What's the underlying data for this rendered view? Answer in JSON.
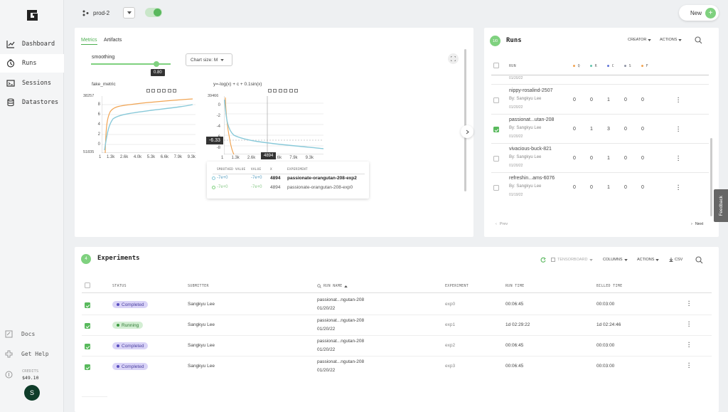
{
  "app": {
    "logo": "G",
    "project": "prod-2",
    "new_button": "New"
  },
  "sidebar": {
    "items": [
      {
        "label": "Dashboard",
        "icon": "chart-line-icon"
      },
      {
        "label": "Runs",
        "icon": "runs-icon"
      },
      {
        "label": "Sessions",
        "icon": "sessions-icon"
      },
      {
        "label": "Datastores",
        "icon": "database-icon"
      }
    ],
    "docs": "Docs",
    "help": "Get Help",
    "credits_label": "CREDITS",
    "credits_value": "$49.10",
    "avatar": "S"
  },
  "metrics": {
    "tabs": [
      "Metrics",
      "Artifacts"
    ],
    "smoothing_label": "smoothing",
    "smoothing_value": "0.80",
    "chart_size": "Chart size: M",
    "left_chart": {
      "title": "fake_metric",
      "y_top": "38257",
      "y_bottom": "51835",
      "y_ticks": [
        "8",
        "6",
        "4",
        "2",
        "0"
      ],
      "x_ticks": [
        "1",
        "1.3k",
        "2.6k",
        "4.0k",
        "5.3k",
        "6.6k",
        "7.9k",
        "9.3k"
      ]
    },
    "right_chart": {
      "title": "y=-log(x) + c + 0.1sin(x)",
      "y_top": "39466",
      "y_ticks": [
        "0",
        "-2",
        "-4",
        "-6",
        "-8"
      ],
      "x_ticks": [
        "1",
        "1.3k",
        "2.6k",
        "4",
        "6.6k",
        "7.9k",
        "9.3k"
      ],
      "hover_y": "-6.33",
      "hover_x": "4894"
    },
    "tooltip": {
      "headers": [
        "SMOOTHED VALUE",
        "VALUE",
        "X",
        "EXPERIMENT"
      ],
      "rows": [
        {
          "smoothed": "-7e+0",
          "value": "-7e+0",
          "x": "4894",
          "experiment": "passionate-orangutan-208-exp2"
        },
        {
          "smoothed": "-7e+0",
          "value": "-7e+0",
          "x": "4894",
          "experiment": "passionate-orangutan-208-exp0"
        }
      ]
    }
  },
  "runs": {
    "badge": "1/0",
    "title": "Runs",
    "creator": "CREATOR",
    "actions": "ACTIONS",
    "headers": [
      "RUN",
      "Q",
      "R",
      "C",
      "S",
      "F"
    ],
    "header_colors": [
      "#f0a04b",
      "#5bc0a8",
      "#5a6fd6",
      "#8a8fa0",
      "#f0a04b"
    ],
    "partial_date": "01/20/22",
    "rows": [
      {
        "name": "nippy-rosalind-2507",
        "by": "By: Sangkyu Lee",
        "date": "01/20/22",
        "q": "0",
        "r": "0",
        "c": "1",
        "s": "0",
        "f": "0",
        "checked": false
      },
      {
        "name": "passionat...utan-208",
        "by": "By: Sangkyu Lee",
        "date": "01/20/22",
        "q": "0",
        "r": "1",
        "c": "3",
        "s": "0",
        "f": "0",
        "checked": true
      },
      {
        "name": "vivacious-buck-821",
        "by": "By: Sangkyu Lee",
        "date": "01/20/22",
        "q": "0",
        "r": "0",
        "c": "1",
        "s": "0",
        "f": "0",
        "checked": false
      },
      {
        "name": "refreshin...ams-6076",
        "by": "By: Sangkyu Lee",
        "date": "01/19/22",
        "q": "0",
        "r": "0",
        "c": "1",
        "s": "0",
        "f": "0",
        "checked": false
      }
    ],
    "prev": "Prev",
    "next": "Next"
  },
  "feedback": "Feedback",
  "experiments": {
    "badge": "4",
    "title": "Experiments",
    "tensorboard": "TENSORBOARD",
    "columns": "COLUMNS",
    "actions": "ACTIONS",
    "csv": "CSV",
    "headers": [
      "STATUS",
      "SUBMITTER",
      "RUN NAME",
      "EXPERIMENT",
      "RUN TIME",
      "BILLED TIME"
    ],
    "rows": [
      {
        "status": "Completed",
        "submitter": "Sangkyu Lee",
        "run_name": "passionat...ngutan-208",
        "date": "01/20/22",
        "experiment": "exp0",
        "run_time": "00:06:45",
        "billed": "00:03:00"
      },
      {
        "status": "Running",
        "submitter": "Sangkyu Lee",
        "run_name": "passionat...ngutan-208",
        "date": "01/20/22",
        "experiment": "exp1",
        "run_time": "1d 02:29:22",
        "billed": "1d 02:24:46"
      },
      {
        "status": "Completed",
        "submitter": "Sangkyu Lee",
        "run_name": "passionat...ngutan-208",
        "date": "01/20/22",
        "experiment": "exp2",
        "run_time": "00:06:45",
        "billed": "00:03:00"
      },
      {
        "status": "Completed",
        "submitter": "Sangkyu Lee",
        "run_name": "passionat...ngutan-208",
        "date": "01/20/22",
        "experiment": "exp3",
        "run_time": "00:06:45",
        "billed": "00:03:00"
      }
    ]
  }
}
